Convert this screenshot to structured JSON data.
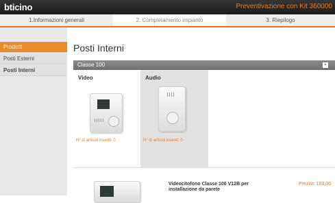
{
  "app": {
    "logo_text": "bticino",
    "title": "Preventivazione con Kit 360000"
  },
  "tabs": [
    {
      "label": "1.Informazioni generali",
      "active": false
    },
    {
      "label": "2. Completamento impianto",
      "active": true
    },
    {
      "label": "3. Riepilogo",
      "active": false
    }
  ],
  "sidebar": {
    "items": [
      {
        "label": "Prodotti",
        "active": true
      },
      {
        "label": "Posti Esterni",
        "active": false
      },
      {
        "label": "Posti Interni",
        "active": false
      }
    ]
  },
  "main": {
    "page_title": "Posti Interni",
    "section_title": "Classe 100",
    "columns": [
      {
        "label": "Video",
        "count_text": "N° di articoli inseriti: 0"
      },
      {
        "label": "Audio",
        "count_text": "N° di articoli inseriti: 0"
      }
    ],
    "product": {
      "description": "Videocitofono Classe 100 V12B per installazione da parete",
      "price": "Prezzo: 103,00"
    }
  },
  "colors": {
    "accent": "#ef8a2a",
    "topbar": "#1c1c1c",
    "section_header": "#7a7a7a"
  }
}
